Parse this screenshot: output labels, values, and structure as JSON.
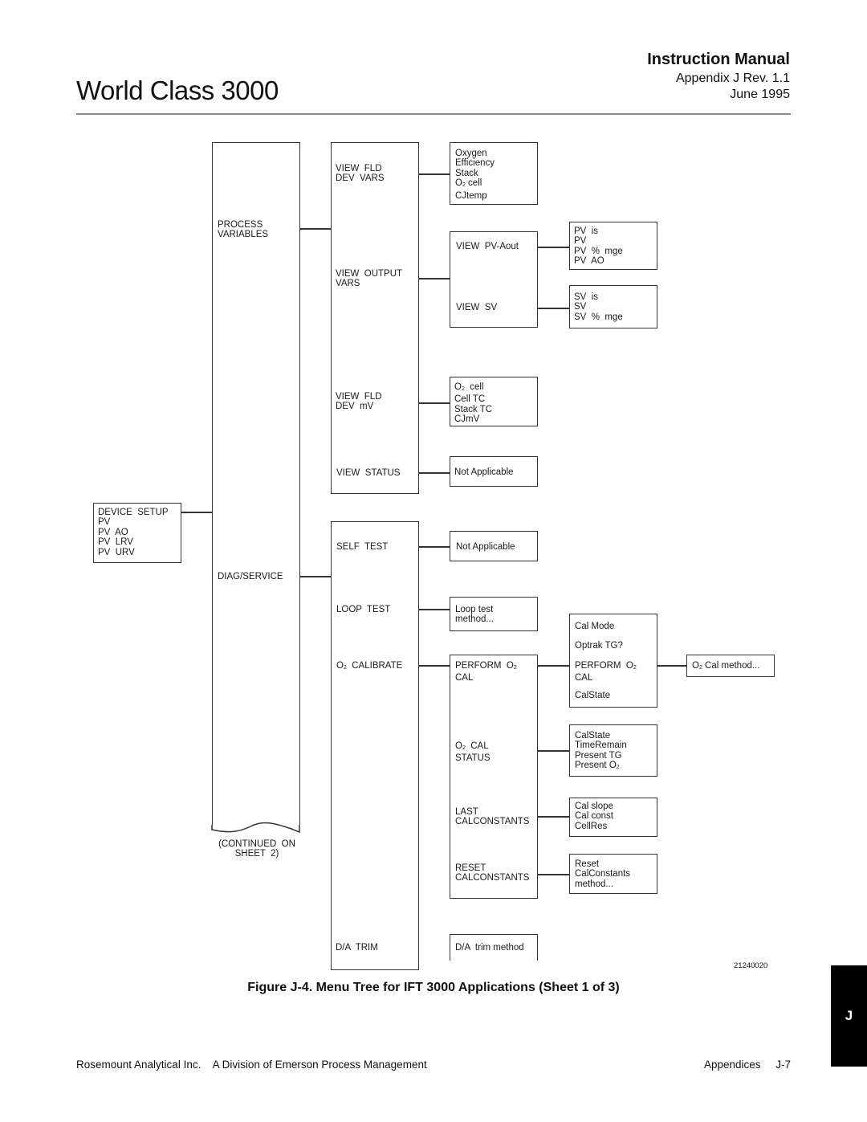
{
  "header": {
    "title": "World Class 3000",
    "manual": "Instruction Manual",
    "revision": "Appendix J  Rev. 1.1",
    "date": "June 1995"
  },
  "diagram": {
    "root": "DEVICE  SETUP\nPV\nPV  AO\nPV  LRV\nPV  URV",
    "level1": {
      "process_variables": "PROCESS\nVARIABLES",
      "diag_service": "DIAG/SERVICE",
      "continued": "(CONTINUED  ON\nSHEET  2)"
    },
    "pv_menu": {
      "view_fld_dev_vars": "VIEW  FLD\nDEV  VARS",
      "view_output_vars": "VIEW  OUTPUT\nVARS",
      "view_fld_dev_mv": "VIEW  FLD\nDEV  mV",
      "view_status": "VIEW  STATUS"
    },
    "diag_menu": {
      "self_test": "SELF  TEST",
      "loop_test": "LOOP  TEST",
      "o2_calibrate_pre": "O",
      "o2_calibrate_sub": "2",
      "o2_calibrate_post": "  CALIBRATE",
      "da_trim": "D/A  TRIM"
    },
    "fld_dev_vars": {
      "line1": "Oxygen\nEfficiency\nStack",
      "o2": "O",
      "o2_sub": "2",
      "o2_post": " cell",
      "line_last": "CJtemp"
    },
    "output_vars": {
      "view_pv_aout": "VIEW  PV-Aout",
      "view_sv": "VIEW  SV"
    },
    "pv_aout_items": "PV  is\nPV\nPV  %  mge\nPV  AO",
    "sv_items": "SV  is\nSV\nSV  %  mge",
    "fld_dev_mv": {
      "o2": "O",
      "o2_sub": "2",
      "o2_post": "  cell",
      "rest": "Cell TC\nStack TC\nCJmV"
    },
    "status_result": "Not Applicable",
    "self_test_result": "Not Applicable",
    "loop_test_result": "Loop test\nmethod...",
    "calibrate_menu": {
      "perform_pre": "PERFORM  O",
      "perform_sub": "2",
      "perform_post": "CAL",
      "status_pre": "O",
      "status_sub": "2",
      "status_post": "  CAL",
      "status_line2": "STATUS",
      "last_cal": "LAST\nCALCONSTANTS",
      "reset_cal": "RESET\nCALCONSTANTS"
    },
    "perform_menu": {
      "cal_mode": "Cal Mode",
      "optrak": "Optrak TG?",
      "perform_pre": "PERFORM  O",
      "perform_sub": "2",
      "perform_post": "CAL",
      "calstate": "CalState"
    },
    "o2_cal_method": {
      "pre": "O",
      "sub": "2",
      "post": " Cal method..."
    },
    "cal_status_items": {
      "lines": "CalState\nTimeRemain\nPresent TG",
      "last_pre": "Present O",
      "last_sub": "2"
    },
    "last_cal_items": "Cal slope\nCal const\nCellRes",
    "reset_cal_items": "Reset\nCalConstants\nmethod...",
    "da_trim_result": "D/A  trim method",
    "drawing_number": "21240020"
  },
  "caption": "Figure J-4.  Menu Tree for IFT 3000 Applications (Sheet 1 of 3)",
  "footer": {
    "left": "Rosemount Analytical Inc.    A Division of Emerson Process Management",
    "right": "Appendices     J-7"
  },
  "tab_letter": "J"
}
